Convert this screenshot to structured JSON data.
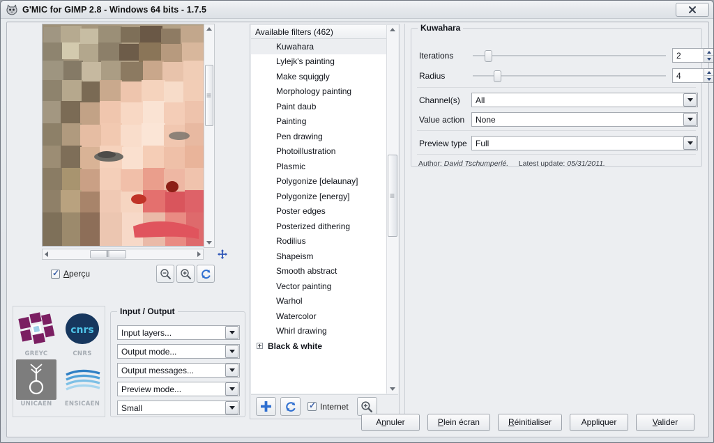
{
  "window": {
    "title": "G'MIC for GIMP 2.8 - Windows 64 bits - 1.7.5",
    "close_label": "✖",
    "app_icon": "cat-icon"
  },
  "preview": {
    "checkbox_label_pre": "A",
    "checkbox_label_post": "perçu",
    "checkbox_checked": true,
    "zoom_out_icon": "zoom-out-icon",
    "zoom_in_icon": "zoom-in-icon",
    "refresh_icon": "refresh-icon",
    "move_icon": "move-icon"
  },
  "logos": [
    {
      "name": "GREYC",
      "caption": "GREYC"
    },
    {
      "name": "CNRS",
      "caption": "CNRS"
    },
    {
      "name": "UNICAEN",
      "caption": "UNICAEN"
    },
    {
      "name": "ENSICAEN",
      "caption": "ENSICAEN"
    }
  ],
  "io_group": {
    "title": "Input / Output",
    "combos": [
      {
        "name": "input-layers",
        "value": "Input layers..."
      },
      {
        "name": "output-mode",
        "value": "Output mode..."
      },
      {
        "name": "output-messages",
        "value": "Output messages..."
      },
      {
        "name": "preview-mode",
        "value": "Preview mode..."
      },
      {
        "name": "preview-size",
        "value": "Small"
      }
    ]
  },
  "filter_list": {
    "header": "Available filters (462)",
    "items": [
      {
        "label": "Kuwahara",
        "selected": true,
        "group": false
      },
      {
        "label": "Lylejk's painting",
        "selected": false,
        "group": false
      },
      {
        "label": "Make squiggly",
        "selected": false,
        "group": false
      },
      {
        "label": "Morphology painting",
        "selected": false,
        "group": false
      },
      {
        "label": "Paint daub",
        "selected": false,
        "group": false
      },
      {
        "label": "Painting",
        "selected": false,
        "group": false
      },
      {
        "label": "Pen drawing",
        "selected": false,
        "group": false
      },
      {
        "label": "Photoillustration",
        "selected": false,
        "group": false
      },
      {
        "label": "Plasmic",
        "selected": false,
        "group": false
      },
      {
        "label": "Polygonize [delaunay]",
        "selected": false,
        "group": false
      },
      {
        "label": "Polygonize [energy]",
        "selected": false,
        "group": false
      },
      {
        "label": "Poster edges",
        "selected": false,
        "group": false
      },
      {
        "label": "Posterized dithering",
        "selected": false,
        "group": false
      },
      {
        "label": "Rodilius",
        "selected": false,
        "group": false
      },
      {
        "label": "Shapeism",
        "selected": false,
        "group": false
      },
      {
        "label": "Smooth abstract",
        "selected": false,
        "group": false
      },
      {
        "label": "Vector painting",
        "selected": false,
        "group": false
      },
      {
        "label": "Warhol",
        "selected": false,
        "group": false
      },
      {
        "label": "Watercolor",
        "selected": false,
        "group": false
      },
      {
        "label": "Whirl drawing",
        "selected": false,
        "group": false
      },
      {
        "label": "Black & white",
        "selected": false,
        "group": true
      }
    ],
    "toolbar": {
      "add_icon": "plus-icon",
      "refresh_icon": "refresh-icon",
      "internet_label": "Internet",
      "internet_checked": true,
      "search_icon": "magnifier-icon"
    }
  },
  "params": {
    "title": "Kuwahara",
    "sliders": [
      {
        "label": "Iterations",
        "value": "2",
        "percent": 6
      },
      {
        "label": "Radius",
        "value": "4",
        "percent": 11
      }
    ],
    "combos": [
      {
        "label": "Channel(s)",
        "value": "All"
      },
      {
        "label": "Value action",
        "value": "None"
      },
      {
        "label": "Preview type",
        "value": "Full"
      }
    ],
    "author_prefix": "Author:",
    "author_name": "David Tschumperlé.",
    "update_prefix": "Latest update:",
    "update_date": "05/31/2011."
  },
  "buttons": [
    {
      "name": "cancel-button",
      "pre": "A",
      "mn": "n",
      "post": "nuler"
    },
    {
      "name": "fullscreen-button",
      "pre": "",
      "mn": "P",
      "post": "lein écran"
    },
    {
      "name": "reset-button",
      "pre": "",
      "mn": "R",
      "post": "éinitialiser"
    },
    {
      "name": "apply-button",
      "pre": "Appliquer",
      "mn": "",
      "post": ""
    },
    {
      "name": "ok-button",
      "pre": "",
      "mn": "V",
      "post": "alider"
    }
  ],
  "colors": {
    "window_bg": "#eceef1",
    "accent_blue": "#2f56b7",
    "field_bg": "#ffffff"
  }
}
